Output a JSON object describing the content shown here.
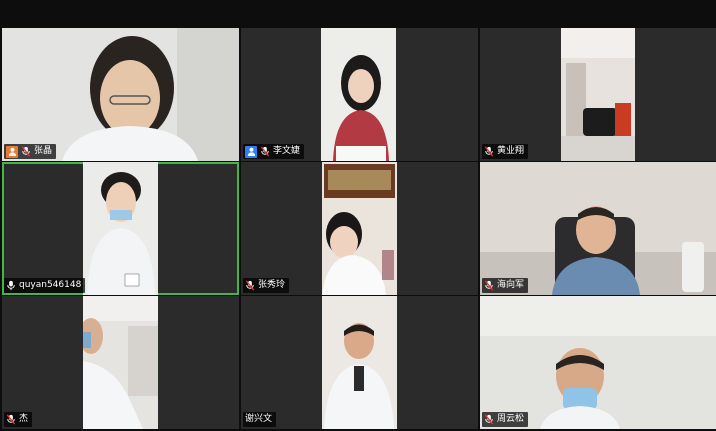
{
  "participants": [
    {
      "name": "张晶",
      "badge": "person-orange",
      "muted": true
    },
    {
      "name": "李文婕",
      "badge": "person-blue",
      "muted": true
    },
    {
      "name": "黄业翔",
      "badge": "",
      "muted": true
    },
    {
      "name": "quyan546148",
      "badge": "",
      "muted": false,
      "speaking": true
    },
    {
      "name": "张秀玲",
      "badge": "",
      "muted": true
    },
    {
      "name": "海向军",
      "badge": "",
      "muted": true
    },
    {
      "name": "杰",
      "badge": "",
      "muted": true
    },
    {
      "name": "谢兴文",
      "badge": "",
      "muted": false
    },
    {
      "name": "周云松",
      "badge": "",
      "muted": true
    }
  ],
  "colors": {
    "active_outline": "#47b34f",
    "badge_orange": "#e8792f",
    "badge_blue": "#2d7ff9"
  }
}
